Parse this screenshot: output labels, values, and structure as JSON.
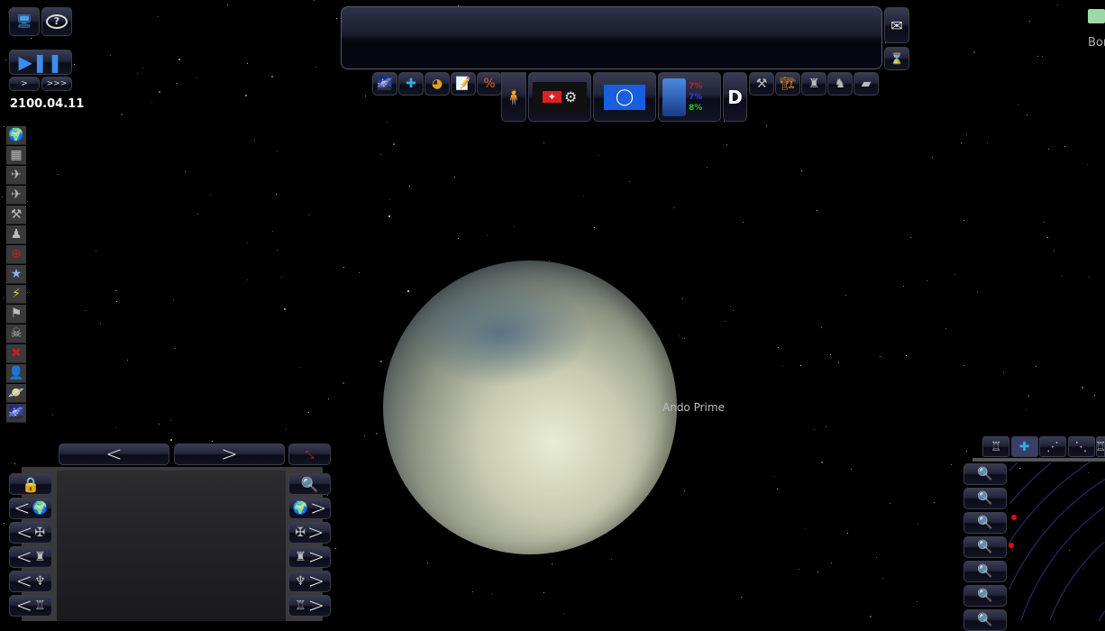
{
  "date": "2100.04.11",
  "speed": {
    "slow_label": ">",
    "fast_label": ">>>"
  },
  "planet": {
    "name": "Ando Prime"
  },
  "top_right": {
    "label": "Bon"
  },
  "faction_stats": [
    {
      "value": "7%",
      "color": "#c0202a"
    },
    {
      "value": "7%",
      "color": "#3a3ad8"
    },
    {
      "value": "8%",
      "color": "#20c020"
    }
  ],
  "top_icons": [
    "galaxy-icon",
    "fleet-icon",
    "pie-chart-icon",
    "notes-icon",
    "percent-icon"
  ],
  "right_icons": [
    "hammer-icon",
    "construction-crane-icon",
    "trooper-icon",
    "walker-icon",
    "tank-icon"
  ],
  "left_toolbar": [
    "planet-icon",
    "map-icon",
    "ship-icon",
    "ship-icon",
    "hammer-icon",
    "droid-icon",
    "target-icon",
    "star-icon",
    "lightning-icon",
    "checkered-flag-icon",
    "pirate-icon",
    "crossed-tools-icon",
    "agent-icon",
    "saturn-icon",
    "galaxy-icon"
  ],
  "left_rows": [
    "planet-icon",
    "starfighter-icon",
    "soldier-icon",
    "cruiser-icon",
    "station-icon"
  ],
  "zoom_buttons": [
    "zoom-fit-icon",
    "zoom-in-icon",
    "zoom-out-icon",
    "zoom-planet-icon",
    "zoom-system-icon",
    "zoom-sector-icon",
    "zoom-galaxy-icon"
  ],
  "map_tabs": [
    "station-icon",
    "fleet-icon",
    "route-icon",
    "route-station-icon"
  ]
}
